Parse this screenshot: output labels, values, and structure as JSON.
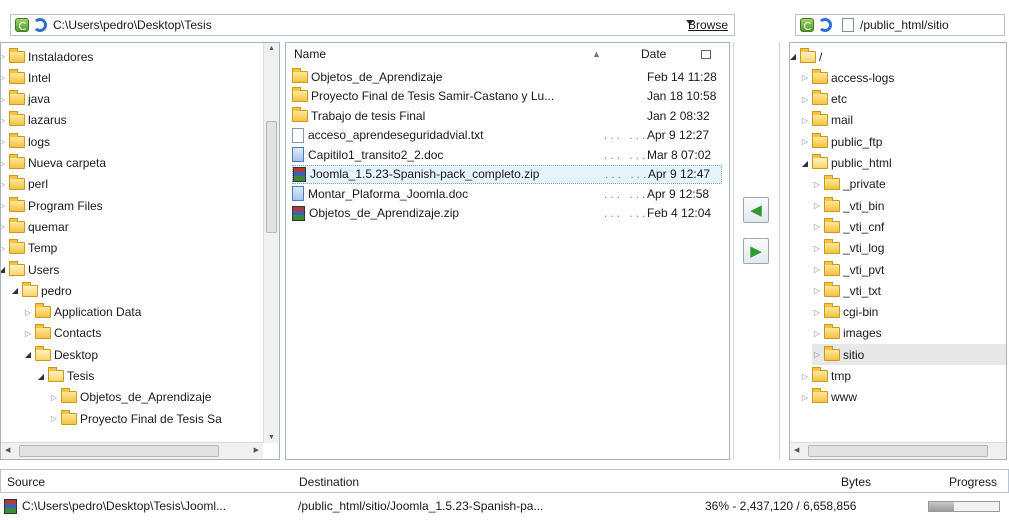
{
  "local": {
    "path": "C:\\Users\\pedro\\Desktop\\Tesis",
    "browse_label": "Browse",
    "tree": [
      {
        "label": "Instaladores",
        "depth": 0,
        "open": false
      },
      {
        "label": "Intel",
        "depth": 0,
        "open": false
      },
      {
        "label": "java",
        "depth": 0,
        "open": false
      },
      {
        "label": "lazarus",
        "depth": 0,
        "open": false
      },
      {
        "label": "logs",
        "depth": 0,
        "open": false
      },
      {
        "label": "Nueva carpeta",
        "depth": 0,
        "open": false
      },
      {
        "label": "perl",
        "depth": 0,
        "open": false
      },
      {
        "label": "Program Files",
        "depth": 0,
        "open": false
      },
      {
        "label": "quemar",
        "depth": 0,
        "open": false
      },
      {
        "label": "Temp",
        "depth": 0,
        "open": false
      },
      {
        "label": "Users",
        "depth": 0,
        "open": true
      },
      {
        "label": "pedro",
        "depth": 1,
        "open": true
      },
      {
        "label": "Application Data",
        "depth": 2,
        "open": false
      },
      {
        "label": "Contacts",
        "depth": 2,
        "open": false
      },
      {
        "label": "Desktop",
        "depth": 2,
        "open": true
      },
      {
        "label": "Tesis",
        "depth": 3,
        "open": true
      },
      {
        "label": "Objetos_de_Aprendizaje",
        "depth": 4,
        "open": false
      },
      {
        "label": "Proyecto Final de Tesis Sa",
        "depth": 4,
        "open": false
      }
    ]
  },
  "files": {
    "col_name": "Name",
    "col_date": "Date",
    "rows": [
      {
        "name": "Objetos_de_Aprendizaje",
        "icon": "folder-icon",
        "dots": "",
        "date": "Feb 14 11:28"
      },
      {
        "name": "Proyecto Final de Tesis Samir-Castano y Lu...",
        "icon": "folder-icon",
        "dots": "",
        "date": "Jan 18 10:58"
      },
      {
        "name": "Trabajo de tesis Final",
        "icon": "folder-icon",
        "dots": "",
        "date": "Jan 2 08:32"
      },
      {
        "name": "acceso_aprendeseguridadvial.txt",
        "icon": "text-file-icon",
        "dots": "... ...",
        "date": "Apr 9 12:27"
      },
      {
        "name": "Capitilo1_transito2_2.doc",
        "icon": "doc-file-icon",
        "dots": "... ...",
        "date": "Mar 8 07:02"
      },
      {
        "name": "Joomla_1.5.23-Spanish-pack_completo.zip",
        "icon": "zip-file-icon",
        "dots": "... ...",
        "date": "Apr 9 12:47"
      },
      {
        "name": "Montar_Plaforma_Joomla.doc",
        "icon": "doc-file-icon",
        "dots": "... ...",
        "date": "Apr 9 12:58"
      },
      {
        "name": "Objetos_de_Aprendizaje.zip",
        "icon": "zip-file-icon",
        "dots": "... ...",
        "date": "Feb 4 12:04"
      }
    ]
  },
  "remote": {
    "path": "/public_html/sitio",
    "tree": [
      {
        "label": "/",
        "depth": 0,
        "open": true
      },
      {
        "label": "access-logs",
        "depth": 1,
        "open": false
      },
      {
        "label": "etc",
        "depth": 1,
        "open": false
      },
      {
        "label": "mail",
        "depth": 1,
        "open": false
      },
      {
        "label": "public_ftp",
        "depth": 1,
        "open": false
      },
      {
        "label": "public_html",
        "depth": 1,
        "open": true
      },
      {
        "label": "_private",
        "depth": 2,
        "open": false
      },
      {
        "label": "_vti_bin",
        "depth": 2,
        "open": false
      },
      {
        "label": "_vti_cnf",
        "depth": 2,
        "open": false
      },
      {
        "label": "_vti_log",
        "depth": 2,
        "open": false
      },
      {
        "label": "_vti_pvt",
        "depth": 2,
        "open": false
      },
      {
        "label": "_vti_txt",
        "depth": 2,
        "open": false
      },
      {
        "label": "cgi-bin",
        "depth": 2,
        "open": false
      },
      {
        "label": "images",
        "depth": 2,
        "open": false
      },
      {
        "label": "sitio",
        "depth": 2,
        "open": false
      },
      {
        "label": "tmp",
        "depth": 1,
        "open": false
      },
      {
        "label": "www",
        "depth": 1,
        "open": false
      }
    ]
  },
  "queue": {
    "col_source": "Source",
    "col_destination": "Destination",
    "col_bytes": "Bytes",
    "col_progress": "Progress",
    "item": {
      "source": "C:\\Users\\pedro\\Desktop\\Tesis\\Jooml...",
      "destination": "/public_html/sitio/Joomla_1.5.23-Spanish-pa...",
      "bytes": "36% - 2,437,120 / 6,658,856",
      "progress": 0.36
    }
  },
  "colors": {
    "accent": "#2f9a2f",
    "selection": "#e5f3fb",
    "folder": "#f5c343"
  }
}
